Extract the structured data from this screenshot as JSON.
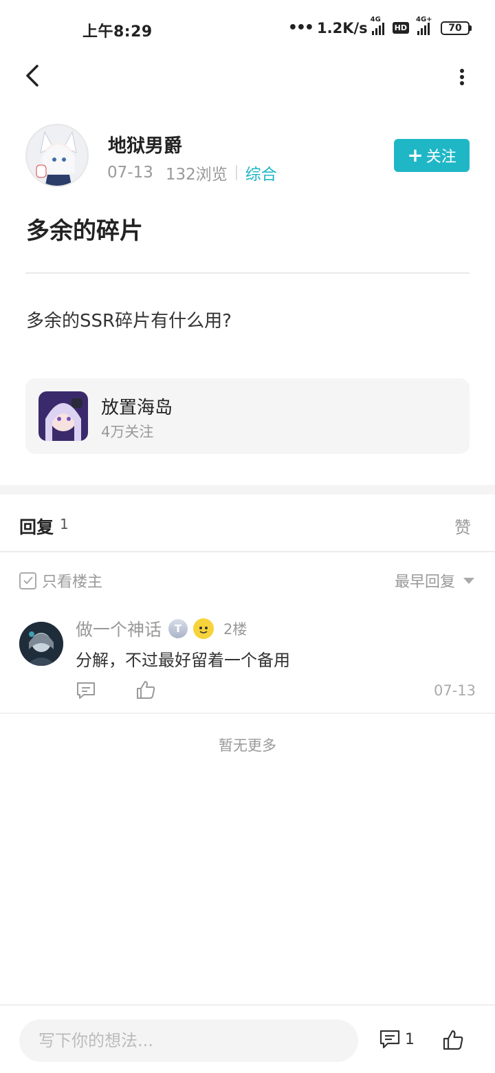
{
  "status_bar": {
    "time": "上午8:29",
    "speed": "1.2K/s",
    "net1": "4G",
    "hd": "HD",
    "net2": "4G+",
    "battery": "70"
  },
  "post": {
    "author": "地狱男爵",
    "date": "07-13",
    "views": "132浏览",
    "category": "综合",
    "follow_label": "关注",
    "title": "多余的碎片",
    "body": "多余的SSR碎片有什么用?"
  },
  "game": {
    "name": "放置海岛",
    "followers": "4万关注"
  },
  "replies": {
    "label": "回复",
    "count": "1",
    "like_tab": "赞",
    "only_op": "只看楼主",
    "sort": "最早回复",
    "items": [
      {
        "user": "做一个神话",
        "badge": "T",
        "floor": "2楼",
        "text": "分解，不过最好留着一个备用",
        "date": "07-13"
      }
    ],
    "no_more": "暂无更多"
  },
  "bottom_bar": {
    "placeholder": "写下你的想法...",
    "comment_count": "1"
  },
  "colors": {
    "accent": "#1fb7c6"
  }
}
